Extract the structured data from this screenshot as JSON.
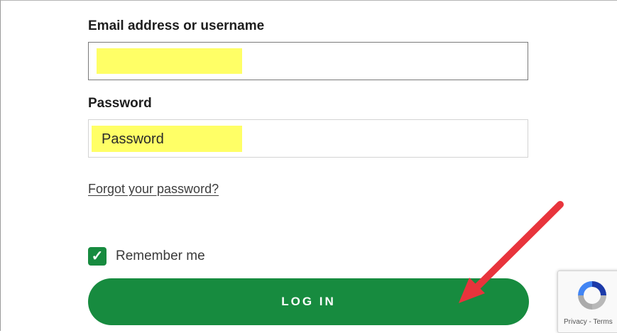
{
  "form": {
    "email_label": "Email address or username",
    "email_value": "",
    "password_label": "Password",
    "password_value": "Password",
    "forgot_link": "Forgot your password?",
    "remember_label": "Remember me",
    "remember_checked": true,
    "checkmark_glyph": "✓",
    "login_label": "LOG IN"
  },
  "recaptcha": {
    "links_text": "Privacy - Terms"
  },
  "colors": {
    "brand_green": "#178b3f",
    "highlight_yellow": "#ffff66",
    "annotation_arrow": "#e8343c"
  },
  "icons": {
    "checkbox": "check-icon",
    "recaptcha": "recaptcha-logo-icon",
    "annotation": "red-arrow-icon"
  }
}
